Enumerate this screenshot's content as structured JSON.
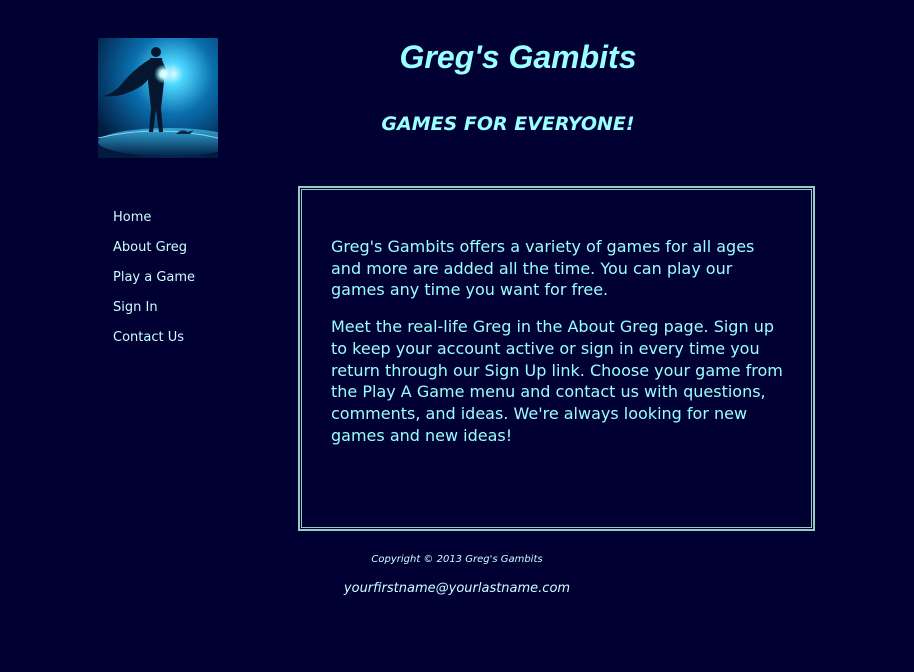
{
  "header": {
    "logo_icon": "superhero-silhouette-icon",
    "title": "Greg's Gambits",
    "tagline": "GAMES FOR EVERYONE!"
  },
  "nav": {
    "items": [
      {
        "label": "Home"
      },
      {
        "label": "About Greg"
      },
      {
        "label": "Play a Game"
      },
      {
        "label": "Sign In"
      },
      {
        "label": "Contact Us"
      }
    ]
  },
  "main": {
    "paragraphs": [
      "Greg's Gambits offers a variety of games for all ages and more are added all the time. You can play our games any time you want for free.",
      "Meet the real-life Greg in the About Greg page. Sign up to keep your account active or sign in every time you return through our Sign Up link. Choose your game from the Play A Game menu and contact us with questions, comments, and ideas. We're always looking for new games and new ideas!"
    ]
  },
  "footer": {
    "copyright": "Copyright © 2013 Greg's Gambits",
    "email": "yourfirstname@yourlastname.com"
  },
  "colors": {
    "background": "#000033",
    "title": "#99ffff",
    "text": "#ccffff",
    "border": "#99ccc0"
  }
}
